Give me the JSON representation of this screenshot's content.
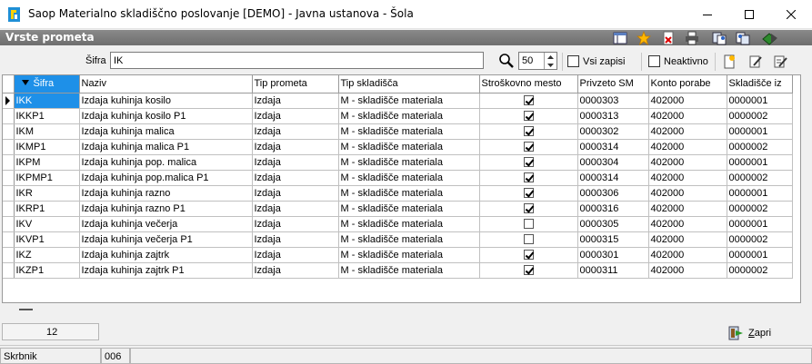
{
  "window": {
    "title": "Saop Materialno skladiščno poslovanje [DEMO] - Javna ustanova - Šola"
  },
  "section": {
    "title": "Vrste prometa"
  },
  "filter": {
    "label": "Šifra",
    "value": "IK",
    "limit": "50",
    "all_records_label": "Vsi zapisi",
    "inactive_label": "Neaktivno"
  },
  "grid": {
    "columns": [
      "Šifra",
      "Naziv",
      "Tip prometa",
      "Tip skladišča",
      "Stroškovno mesto",
      "Privzeto SM",
      "Konto porabe",
      "Skladišče iz"
    ],
    "rows": [
      {
        "code": "IKK",
        "name": "Izdaja kuhinja kosilo",
        "type": "Izdaja",
        "store_type": "M - skladišče materiala",
        "cost_center": true,
        "default_cc": "0000303",
        "account": "402000",
        "store_from": "0000001"
      },
      {
        "code": "IKKP1",
        "name": "Izdaja kuhinja kosilo P1",
        "type": "Izdaja",
        "store_type": "M - skladišče materiala",
        "cost_center": true,
        "default_cc": "0000313",
        "account": "402000",
        "store_from": "0000002"
      },
      {
        "code": "IKM",
        "name": "Izdaja kuhinja malica",
        "type": "Izdaja",
        "store_type": "M - skladišče materiala",
        "cost_center": true,
        "default_cc": "0000302",
        "account": "402000",
        "store_from": "0000001"
      },
      {
        "code": "IKMP1",
        "name": "Izdaja kuhinja malica P1",
        "type": "Izdaja",
        "store_type": "M - skladišče materiala",
        "cost_center": true,
        "default_cc": "0000314",
        "account": "402000",
        "store_from": "0000002"
      },
      {
        "code": "IKPM",
        "name": "Izdaja kuhinja pop. malica",
        "type": "Izdaja",
        "store_type": "M - skladišče materiala",
        "cost_center": true,
        "default_cc": "0000304",
        "account": "402000",
        "store_from": "0000001"
      },
      {
        "code": "IKPMP1",
        "name": "Izdaja kuhinja pop.malica P1",
        "type": "Izdaja",
        "store_type": "M - skladišče materiala",
        "cost_center": true,
        "default_cc": "0000314",
        "account": "402000",
        "store_from": "0000002"
      },
      {
        "code": "IKR",
        "name": "Izdaja kuhinja razno",
        "type": "Izdaja",
        "store_type": "M - skladišče materiala",
        "cost_center": true,
        "default_cc": "0000306",
        "account": "402000",
        "store_from": "0000001"
      },
      {
        "code": "IKRP1",
        "name": "Izdaja kuhinja razno P1",
        "type": "Izdaja",
        "store_type": "M - skladišče materiala",
        "cost_center": true,
        "default_cc": "0000316",
        "account": "402000",
        "store_from": "0000002"
      },
      {
        "code": "IKV",
        "name": "Izdaja kuhinja večerja",
        "type": "Izdaja",
        "store_type": "M - skladišče materiala",
        "cost_center": false,
        "default_cc": "0000305",
        "account": "402000",
        "store_from": "0000001"
      },
      {
        "code": "IKVP1",
        "name": "Izdaja kuhinja večerja P1",
        "type": "Izdaja",
        "store_type": "M - skladišče materiala",
        "cost_center": false,
        "default_cc": "0000315",
        "account": "402000",
        "store_from": "0000002"
      },
      {
        "code": "IKZ",
        "name": "Izdaja kuhinja zajtrk",
        "type": "Izdaja",
        "store_type": "M - skladišče materiala",
        "cost_center": true,
        "default_cc": "0000301",
        "account": "402000",
        "store_from": "0000001"
      },
      {
        "code": "IKZP1",
        "name": "Izdaja kuhinja zajtrk P1",
        "type": "Izdaja",
        "store_type": "M - skladišče materiala",
        "cost_center": true,
        "default_cc": "0000311",
        "account": "402000",
        "store_from": "0000002"
      }
    ]
  },
  "footer": {
    "record_count": "12",
    "close_label_first": "Z",
    "close_label_rest": "apri"
  },
  "status": {
    "user": "Skrbnik",
    "code": "006"
  },
  "colors": {
    "selection": "#1e90e8",
    "section_bar": "#7a7a7a"
  }
}
